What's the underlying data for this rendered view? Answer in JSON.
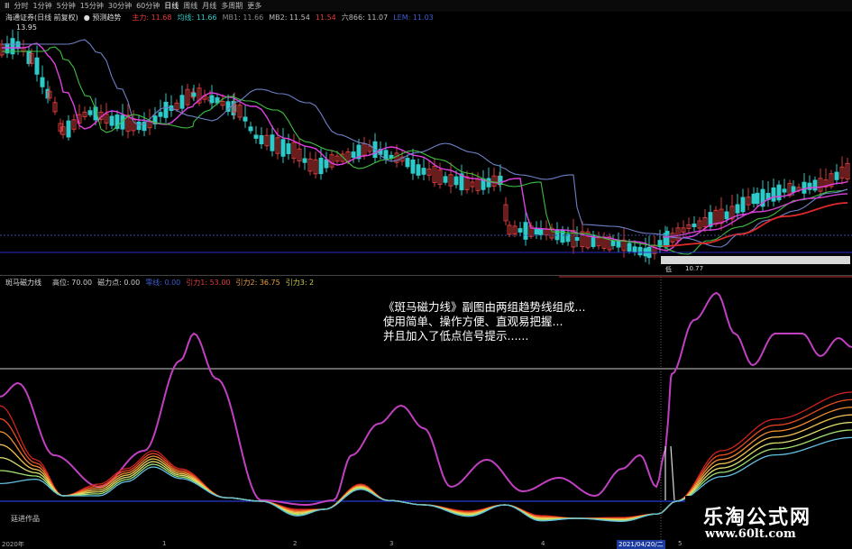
{
  "toolbar": {
    "items": [
      "Ⅲ",
      "分时",
      "1分钟",
      "5分钟",
      "15分钟",
      "30分钟",
      "60分钟",
      "日线",
      "周线",
      "月线",
      "多周期",
      "更多"
    ],
    "active_index": 7
  },
  "main": {
    "stock_name": "海通证券(日线 前复权)",
    "indicator": "● 预测趋势",
    "ma_labels": [
      {
        "text": "主力: 11.68",
        "color": "#e23c3c"
      },
      {
        "text": "均线: 11.66",
        "color": "#2ec9c9"
      },
      {
        "text": "MB1: 11.66",
        "color": "#888888"
      },
      {
        "text": "MB2: 11.54",
        "color": "#bbbbbb"
      },
      {
        "text": "11.54",
        "color": "#e23c3c"
      },
      {
        "text": "六866: 11.07",
        "color": "#bbbbbb"
      },
      {
        "text": "LEM: 11.03",
        "color": "#3c5ccc"
      }
    ],
    "high_label": "13.95",
    "low_label": "10.77",
    "low_marker": "低"
  },
  "sub": {
    "name": "斑马磁力线",
    "labels": [
      {
        "text": "高位: 70.00",
        "color": "#cccccc"
      },
      {
        "text": "磁力点: 0.00",
        "color": "#cccccc"
      },
      {
        "text": "零线: 0.00",
        "color": "#3c5ccc"
      },
      {
        "text": "引力1: 53.00",
        "color": "#e23c3c"
      },
      {
        "text": "引力2: 36.75",
        "color": "#e8a040"
      },
      {
        "text": "引力3: 2",
        "color": "#cccc40"
      }
    ]
  },
  "annotation": {
    "lines": [
      "《斑马磁力线》副图由两组趋势线组成...",
      "使用简单、操作方便、直观易把握...",
      "并且加入了低点信号提示......"
    ]
  },
  "author": "廷进作品",
  "date_axis": {
    "labels": [
      "2020年",
      "1",
      "2",
      "3",
      "4",
      "2021/04/20/二",
      "5"
    ]
  },
  "brand": {
    "name": "乐淘公式网",
    "url": "www.60lt.com"
  },
  "colors": {
    "up": "#d33a3a",
    "down": "#2ec9c9",
    "ma_short": "#e040e0",
    "ma_mid": "#3fbf3f",
    "ma_long": "#6f80c8",
    "mag1": "#c040c0",
    "zero": "#2030b0"
  }
}
